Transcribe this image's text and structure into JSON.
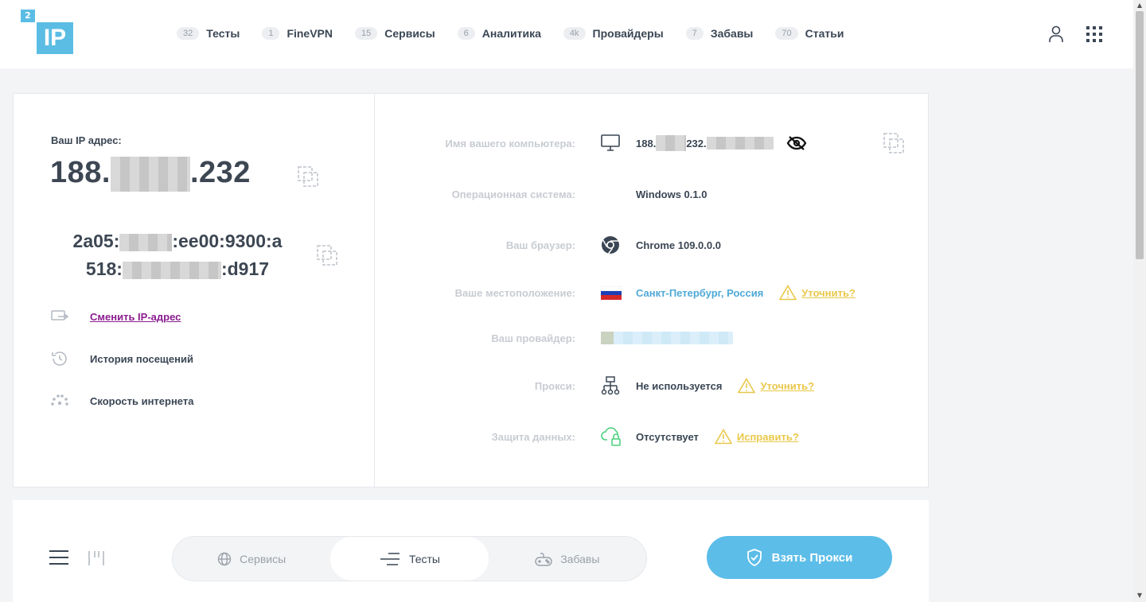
{
  "header": {
    "logo_badge": "2",
    "logo_text": "IP",
    "nav": [
      {
        "count": "32",
        "label": "Тесты"
      },
      {
        "count": "1",
        "label": "FineVPN"
      },
      {
        "count": "15",
        "label": "Сервисы"
      },
      {
        "count": "6",
        "label": "Аналитика"
      },
      {
        "count": "4k",
        "label": "Провайдеры"
      },
      {
        "count": "7",
        "label": "Забавы"
      },
      {
        "count": "70",
        "label": "Статьи"
      }
    ]
  },
  "ip_panel": {
    "label": "Ваш IP адрес:",
    "ipv4_prefix": "188.",
    "ipv4_suffix": ".232",
    "ipv6_line1_prefix": "2a05:",
    "ipv6_line1_suffix": ":ee00:9300:a",
    "ipv6_line2_prefix": "518:",
    "ipv6_line2_suffix": ":d917",
    "actions": [
      {
        "label": "Сменить IP-адрес",
        "icon": "change-ip-icon"
      },
      {
        "label": "История посещений",
        "icon": "history-icon"
      },
      {
        "label": "Скорость интернета",
        "icon": "speedometer-icon"
      }
    ]
  },
  "info": {
    "computer_name": {
      "key": "Имя вашего компьютера:",
      "value_prefix": "188.",
      "value_mid": "232."
    },
    "os": {
      "key": "Операционная система:",
      "value": "Windows 0.1.0"
    },
    "browser": {
      "key": "Ваш браузер:",
      "value": "Chrome 109.0.0.0"
    },
    "location": {
      "key": "Ваше местоположение:",
      "value": "Санкт-Петербург, Россия",
      "warn": "Уточнить?"
    },
    "provider": {
      "key": "Ваш провайдер:"
    },
    "proxy": {
      "key": "Прокси:",
      "value": "Не используется",
      "warn": "Уточнить?"
    },
    "protection": {
      "key": "Защита данных:",
      "value": "Отсутствует",
      "warn": "Исправить?"
    }
  },
  "bottom": {
    "tabs": [
      {
        "label": "Сервисы",
        "icon": "globe-icon"
      },
      {
        "label": "Тесты",
        "icon": "lines-icon"
      },
      {
        "label": "Забавы",
        "icon": "gamepad-icon"
      }
    ],
    "proxy_button": "Взять Прокси"
  },
  "colors": {
    "accent": "#5bbde4",
    "warning": "#e9c84b",
    "link": "#8a1c8f"
  }
}
